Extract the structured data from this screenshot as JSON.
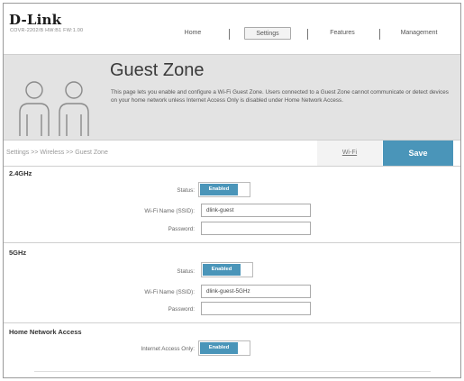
{
  "header": {
    "brand": "D-Link",
    "model": "COVR-2202/B HW:B1 FW:1.00"
  },
  "nav": {
    "items": [
      {
        "label": "Home"
      },
      {
        "label": "Settings"
      },
      {
        "label": "Features"
      },
      {
        "label": "Management"
      }
    ],
    "active": "Settings"
  },
  "banner": {
    "title": "Guest Zone",
    "description": "This page lets you enable and configure a Wi-Fi Guest Zone. Users connected to a Guest Zone cannot communicate or detect devices on your home network unless Internet Access Only is disabled under Home Network Access.",
    "icon": "two-people-icon"
  },
  "breadcrumb": "Settings >> Wireless >> Guest Zone",
  "actions": {
    "wifi_link": "Wi-Fi",
    "save": "Save"
  },
  "sections": {
    "band24": {
      "title": "2.4GHz",
      "status_label": "Status:",
      "status_value": "Enabled",
      "ssid_label": "Wi-Fi Name (SSID):",
      "ssid_value": "dlink-guest",
      "password_label": "Password:",
      "password_value": ""
    },
    "band5": {
      "title": "5GHz",
      "status_label": "Status:",
      "status_value": "Enabled",
      "ssid_label": "Wi-Fi Name (SSID):",
      "ssid_value": "dlink-guest-5GHz",
      "password_label": "Password:",
      "password_value": ""
    },
    "home_network": {
      "title": "Home Network Access",
      "internet_only_label": "Internet Access Only:",
      "internet_only_value": "Enabled"
    }
  },
  "colors": {
    "accent": "#4a95b9",
    "banner_bg": "#e3e3e3"
  }
}
